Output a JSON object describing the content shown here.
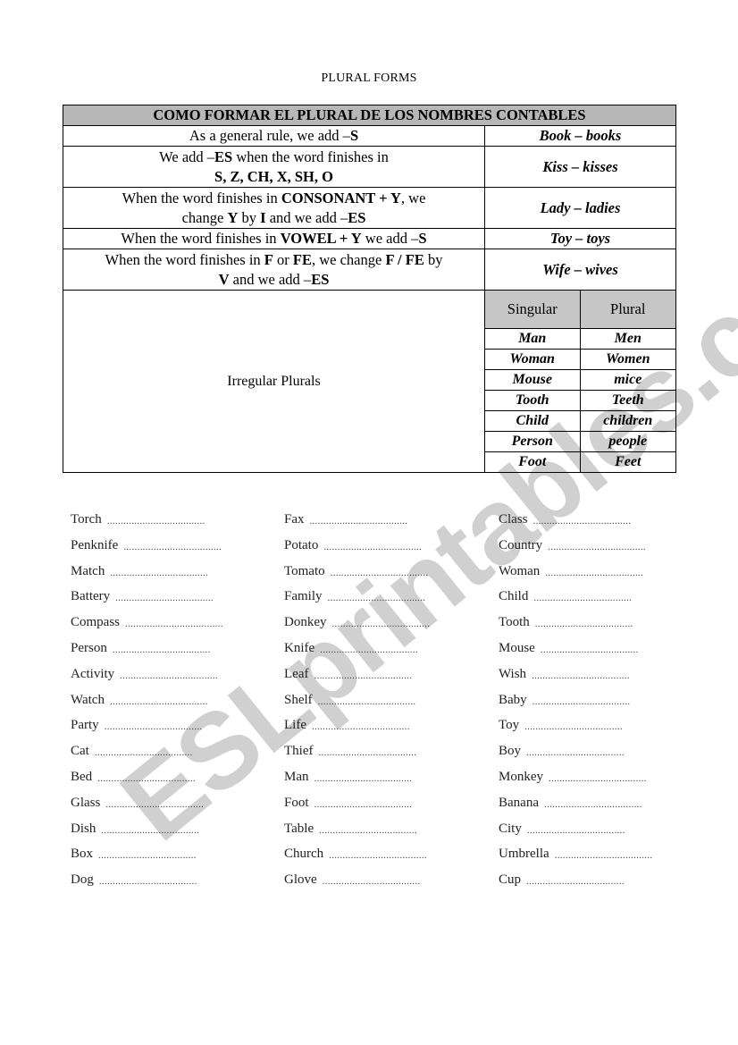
{
  "document": {
    "title": "PLURAL FORMS",
    "rules_table": {
      "header": "COMO FORMAR EL PLURAL DE LOS NOMBRES CONTABLES",
      "rows": [
        {
          "rule_parts": [
            {
              "t": "As a general rule, we add  –"
            },
            {
              "t": "S",
              "b": true
            }
          ],
          "example": "Book – books"
        },
        {
          "rule_parts": [
            {
              "t": "We add –"
            },
            {
              "t": "ES",
              "b": true
            },
            {
              "t": " when the word finishes in"
            },
            {
              "br": true
            },
            {
              "t": "S, Z, CH, X, SH, O",
              "b": true
            }
          ],
          "example": "Kiss – kisses"
        },
        {
          "rule_parts": [
            {
              "t": "When the word finishes in "
            },
            {
              "t": "CONSONANT + Y",
              "b": true
            },
            {
              "t": ", we"
            },
            {
              "br": true
            },
            {
              "t": "change  "
            },
            {
              "t": "Y",
              "b": true
            },
            {
              "t": " by "
            },
            {
              "t": "I",
              "b": true
            },
            {
              "t": " and we add –"
            },
            {
              "t": "ES",
              "b": true
            }
          ],
          "example": "Lady – ladies"
        },
        {
          "rule_parts": [
            {
              "t": "When the word finishes in "
            },
            {
              "t": "VOWEL + Y",
              "b": true
            },
            {
              "t": " we add –"
            },
            {
              "t": "S",
              "b": true
            }
          ],
          "example": "Toy – toys"
        },
        {
          "rule_parts": [
            {
              "t": "When the word finishes in  "
            },
            {
              "t": "F",
              "b": true
            },
            {
              "t": " or "
            },
            {
              "t": "FE",
              "b": true
            },
            {
              "t": ", we change "
            },
            {
              "t": "F / FE",
              "b": true
            },
            {
              "t": " by"
            },
            {
              "br": true
            },
            {
              "t": "V",
              "b": true
            },
            {
              "t": " and we add –"
            },
            {
              "t": "ES",
              "b": true
            }
          ],
          "example": "Wife – wives"
        }
      ],
      "irregular": {
        "label": "Irregular Plurals",
        "col_singular": "Singular",
        "col_plural": "Plural",
        "pairs": [
          {
            "singular": "Man",
            "plural": "Men"
          },
          {
            "singular": "Woman",
            "plural": "Women"
          },
          {
            "singular": "Mouse",
            "plural": "mice"
          },
          {
            "singular": "Tooth",
            "plural": "Teeth"
          },
          {
            "singular": "Child",
            "plural": "children"
          },
          {
            "singular": "Person",
            "plural": "people"
          },
          {
            "singular": "Foot",
            "plural": "Feet"
          }
        ]
      }
    },
    "exercise_columns": [
      [
        "Torch",
        "Penknife",
        "Match",
        "Battery",
        "Compass",
        "Person",
        "Activity",
        "Watch",
        "Party",
        "Cat",
        "Bed",
        "Glass",
        "Dish",
        "Box",
        "Dog"
      ],
      [
        "Fax",
        "Potato",
        "Tomato",
        "Family",
        "Donkey",
        "Knife",
        "Leaf",
        "Shelf",
        "Life",
        "Thief",
        "Man",
        "Foot",
        "Table",
        "Church",
        "Glove"
      ],
      [
        "Class",
        "Country",
        "Woman",
        "Child",
        "Tooth",
        "Mouse",
        "Wish",
        "Baby",
        "Toy",
        "Boy",
        "Monkey",
        "Banana",
        "City",
        "Umbrella",
        "Cup"
      ]
    ],
    "blank_dots": "....................................",
    "watermark": "ESLprintables.com"
  }
}
